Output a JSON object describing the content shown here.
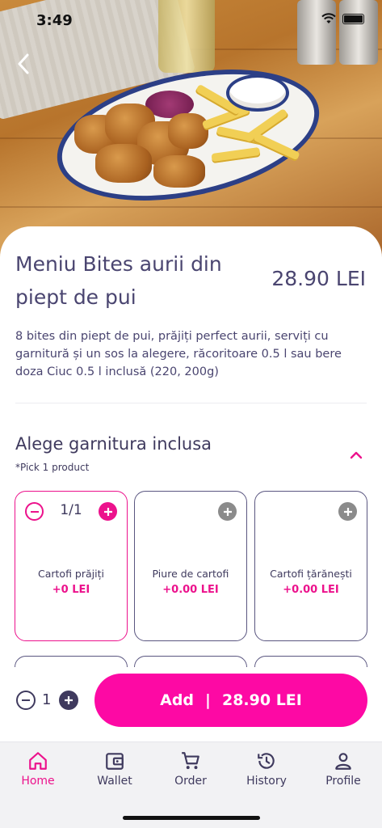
{
  "status_bar": {
    "time": "3:49"
  },
  "product": {
    "title": "Meniu Bites aurii din piept de pui",
    "price": "28.90 LEI",
    "description": "8 bites din piept de pui, prăjiți perfect aurii, serviți cu garnitură și un sos la alegere, răcoritoare 0.5 l sau bere doza Ciuc 0.5 l inclusă (220, 200g)"
  },
  "garnish_section": {
    "title": "Alege garnitura inclusa",
    "subtitle": "*Pick 1 product",
    "options": [
      {
        "name": "Cartofi prăjiți",
        "price": "+0 LEI",
        "counter": "1/1",
        "selected": true
      },
      {
        "name": "Piure de cartofi",
        "price": "+0.00 LEI",
        "selected": false
      },
      {
        "name": "Cartofi țărănești",
        "price": "+0.00 LEI",
        "selected": false
      }
    ]
  },
  "cart": {
    "quantity": "1",
    "add_label": "Add",
    "separator": "|",
    "total": "28.90 LEI"
  },
  "tabbar": {
    "items": [
      {
        "label": "Home",
        "icon": "home-icon",
        "active": true
      },
      {
        "label": "Wallet",
        "icon": "wallet-icon",
        "active": false
      },
      {
        "label": "Order",
        "icon": "cart-icon",
        "active": false
      },
      {
        "label": "History",
        "icon": "history-icon",
        "active": false
      },
      {
        "label": "Profile",
        "icon": "profile-icon",
        "active": false
      }
    ]
  },
  "colors": {
    "accent": "#ec128c",
    "button": "#fd09a4",
    "text": "#3f3a5e"
  }
}
